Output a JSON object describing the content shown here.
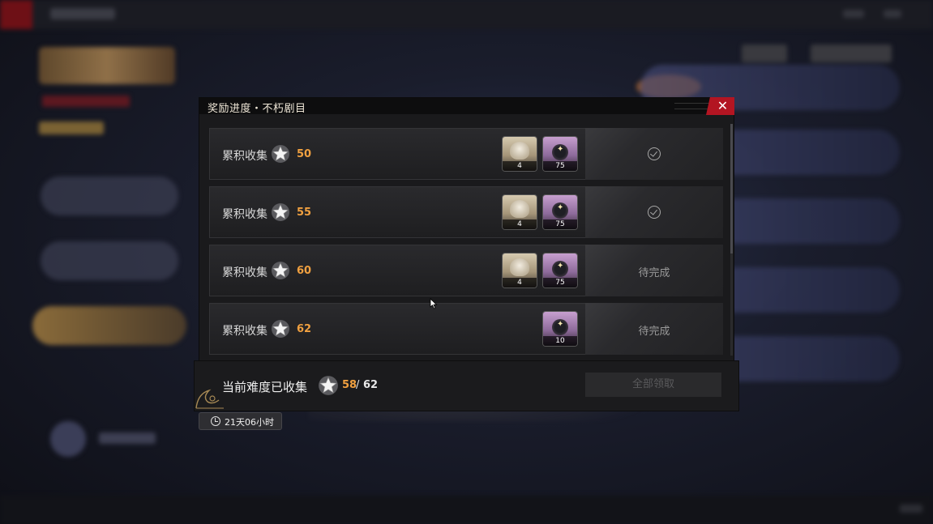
{
  "modal": {
    "title": "奖励进度・不朽剧目",
    "close_symbol": "✕"
  },
  "rows": [
    {
      "label": "累积收集",
      "value": "50",
      "items": [
        {
          "type": "character",
          "count": "4"
        },
        {
          "type": "material",
          "count": "75"
        }
      ],
      "status": "claimed"
    },
    {
      "label": "累积收集",
      "value": "55",
      "items": [
        {
          "type": "character",
          "count": "4"
        },
        {
          "type": "material",
          "count": "75"
        }
      ],
      "status": "claimed"
    },
    {
      "label": "累积收集",
      "value": "60",
      "items": [
        {
          "type": "character",
          "count": "4"
        },
        {
          "type": "material",
          "count": "75"
        }
      ],
      "status": "待完成"
    },
    {
      "label": "累积收集",
      "value": "62",
      "items": [
        {
          "type": "material",
          "count": "10"
        }
      ],
      "status": "待完成"
    }
  ],
  "footer": {
    "label": "当前难度已收集",
    "collected": "58",
    "separator": "/",
    "total": "62",
    "claim_all_label": "全部领取"
  },
  "timer": {
    "text": "21天06小时"
  },
  "colors": {
    "accent_value": "#f0a040",
    "close_red": "#b31522"
  },
  "icons": {
    "star": "star-icon",
    "check": "check-circle-icon",
    "clock": "clock-icon",
    "close": "close-icon"
  }
}
